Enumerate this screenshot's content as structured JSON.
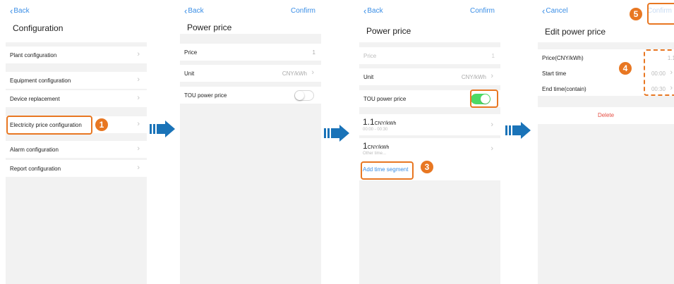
{
  "screen1": {
    "back_label": "Back",
    "title": "Configuration",
    "items": [
      {
        "label": "Plant configuration"
      },
      {
        "label": "Equipment configuration"
      },
      {
        "label": "Device replacement"
      },
      {
        "label": "Electricity price configuration"
      },
      {
        "label": "Alarm configuration"
      },
      {
        "label": "Report configuration"
      }
    ],
    "badge": "1"
  },
  "screen2": {
    "back_label": "Back",
    "confirm_label": "Confirm",
    "title": "Power price",
    "price_label": "Price",
    "price_value": "1",
    "unit_label": "Unit",
    "unit_value": "CNY/kWh",
    "tou_label": "TOU power price",
    "tou_on": false
  },
  "screen3": {
    "back_label": "Back",
    "confirm_label": "Confirm",
    "title": "Power price",
    "price_label": "Price",
    "price_value": "1",
    "unit_label": "Unit",
    "unit_value": "CNY/kWh",
    "tou_label": "TOU power price",
    "tou_on": true,
    "segments": [
      {
        "price": "1.1",
        "unit": "CNY/kWh",
        "time": "00:00 - 00:30"
      },
      {
        "price": "1",
        "unit": "CNY/kWh",
        "time": "Other time..."
      }
    ],
    "add_segment_label": "Add time segment",
    "badge": "3"
  },
  "screen4": {
    "cancel_label": "Cancel",
    "confirm_label": "Confirm",
    "title": "Edit power price",
    "price_label": "Price(CNY/kWh)",
    "price_value": "1.1",
    "start_label": "Start time",
    "start_value": "00:00",
    "end_label": "End time(contain)",
    "end_value": "00:30",
    "delete_label": "Delete",
    "badge_fields": "4",
    "badge_confirm": "5"
  },
  "colors": {
    "accent": "#3a8ee6",
    "highlight": "#e87722",
    "toggle_on": "#4cd964",
    "delete": "#e54d42",
    "arrow": "#1a73b8"
  }
}
